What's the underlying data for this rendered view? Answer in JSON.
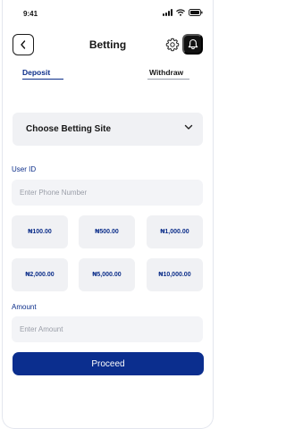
{
  "status_bar": {
    "time": "9:41"
  },
  "header": {
    "title": "Betting"
  },
  "tabs": [
    {
      "label": "Deposit",
      "active": true
    },
    {
      "label": "Withdraw",
      "active": false
    }
  ],
  "site_select": {
    "label": "Choose Betting Site"
  },
  "user_id": {
    "label": "User ID",
    "placeholder": "Enter Phone Number"
  },
  "amount_options": [
    "₦100.00",
    "₦500.00",
    "₦1,000.00",
    "₦2,000.00",
    "₦5,000.00",
    "₦10,000.00"
  ],
  "amount": {
    "label": "Amount",
    "placeholder": "Enter Amount"
  },
  "proceed": {
    "label": "Proceed"
  },
  "colors": {
    "primary": "#0b2e8e",
    "field_bg": "#f0f1f4",
    "bell_bg": "#121212"
  },
  "icons": {
    "back": "chevron-left-icon",
    "settings": "gear-icon",
    "notifications": "bell-icon",
    "dropdown": "chevron-down-icon"
  }
}
